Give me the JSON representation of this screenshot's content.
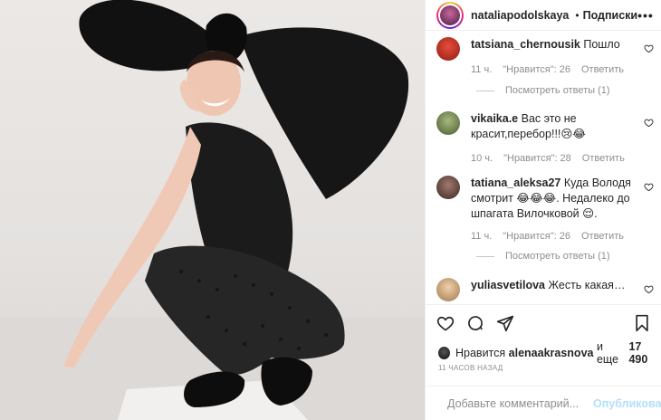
{
  "post": {
    "username": "nataliapodolskaya",
    "follow_label": "Подписки",
    "separator": "•",
    "more_label": "•••"
  },
  "comments": [
    {
      "user": "tatsiana_chernousik",
      "text": "Пошло",
      "time": "11 ч.",
      "likes": "\"Нравится\": 26",
      "reply": "Ответить",
      "view_replies": "Посмотреть ответы (1)",
      "avatar_color": "#c0392b"
    },
    {
      "user": "vikaika.e",
      "text": "Вас это не красит,перебор!!!😢😂",
      "time": "10 ч.",
      "likes": "\"Нравится\": 28",
      "reply": "Ответить",
      "avatar_color": "#7a8b56"
    },
    {
      "user": "tatiana_aleksa27",
      "text": "Куда Володя смотрит 😂😂😂. Недалеко до шпагата Вилочковой 😌.",
      "time": "11 ч.",
      "likes": "\"Нравится\": 26",
      "reply": "Ответить",
      "view_replies": "Посмотреть ответы (1)",
      "avatar_color": "#6b4b45"
    },
    {
      "user": "yuliasvetilova",
      "text": "Жесть какая…",
      "avatar_color": "#d8b08a"
    }
  ],
  "likes_line": {
    "prefix": "Нравится",
    "user": "alenaakrasnova",
    "middle": "и еще",
    "count": "17 490"
  },
  "timestamp": "11 ЧАСОВ НАЗАД",
  "add_comment": {
    "placeholder": "Добавьте комментарий...",
    "publish_label": "Опубликовать"
  },
  "colors": {
    "link_disabled": "#b2dffc",
    "muted": "#8e8e8e",
    "text": "#262626"
  }
}
